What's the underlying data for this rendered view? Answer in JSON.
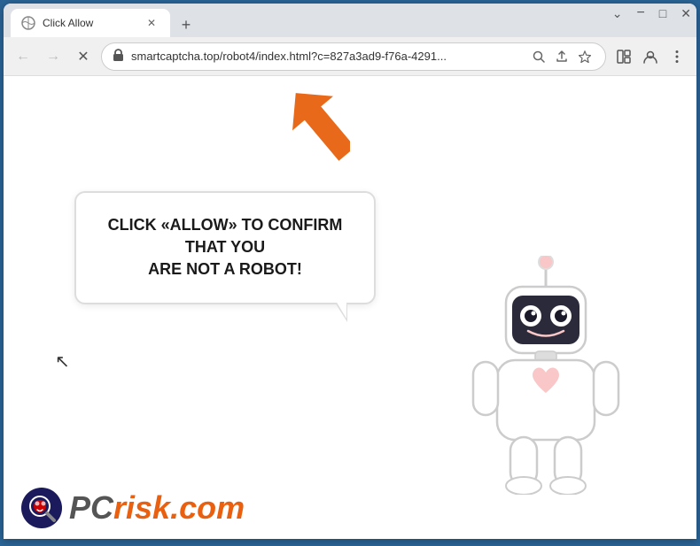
{
  "browser": {
    "tab": {
      "title": "Click Allow",
      "favicon": "🔒"
    },
    "new_tab_label": "+",
    "window_controls": {
      "minimize": "−",
      "maximize": "□",
      "close": "✕",
      "chevron": "⌄"
    },
    "nav": {
      "back": "←",
      "forward": "→",
      "reload": "✕",
      "address": "smartcaptcha.top/robot4/index.html?c=827a3ad9-f76a-4291...",
      "lock": "🔒",
      "search_icon": "🔍",
      "share_icon": "⬆",
      "bookmark_icon": "☆",
      "extensions_icon": "▯",
      "profile_icon": "👤",
      "menu_icon": "⋮"
    }
  },
  "page": {
    "bubble_text_line1": "CLICK «ALLOW» TO CONFIRM THAT YOU",
    "bubble_text_line2": "ARE NOT A ROBOT!",
    "pcrisk_text": "PC",
    "pcrisk_suffix": "risk.com"
  }
}
